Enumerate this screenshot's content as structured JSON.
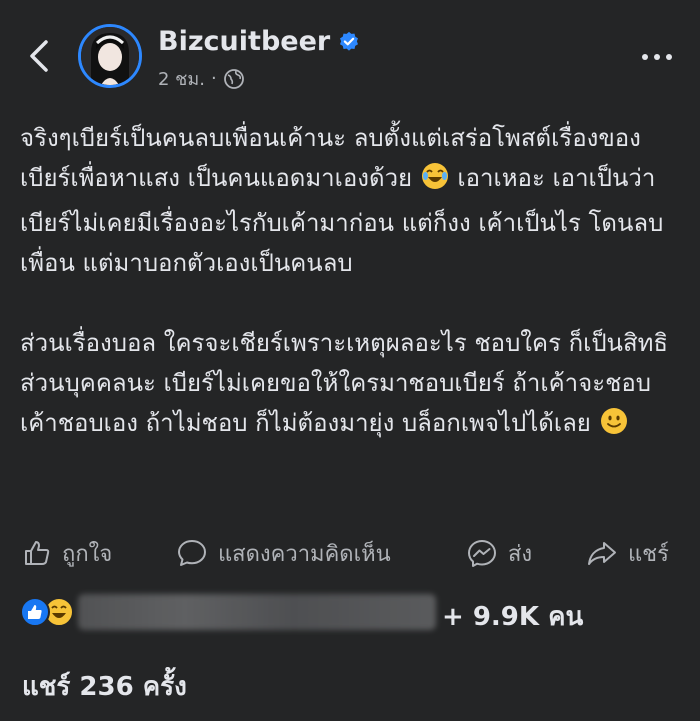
{
  "header": {
    "author_name": "Bizcuitbeer",
    "time": "2 ชม.",
    "separator": "·",
    "verified_icon": "verified-badge-icon",
    "privacy_icon": "globe-icon",
    "accent_color": "#2d88ff"
  },
  "post": {
    "paragraph1_text": "จริงๆเบียร์เป็นคนลบเพื่อนเค้านะ ลบตั้งแต่เสร่อโพสต์เรื่องของเบียร์เพื่อหาแสง เป็นคนแอดมาเองด้วย",
    "paragraph1_emoji": "😂",
    "paragraph1_text2": " เอาเหอะ เอาเป็นว่าเบียร์ไม่เคยมีเรื่องอะไรกับเค้ามาก่อน แต่ก็งง เค้าเป็นไร โดนลบเพื่อน แต่มาบอกตัวเองเป็นคนลบ",
    "paragraph2_text": "ส่วนเรื่องบอล ใครจะเชียร์เพราะเหตุผลอะไร ชอบใคร ก็เป็นสิทธิส่วนบุคคลนะ เบียร์ไม่เคยขอให้ใครมาชอบเบียร์ ถ้าเค้าจะชอบ เค้าชอบเอง ถ้าไม่ชอบ ก็ไม่ต้องมายุ่ง บล็อกเพจไปได้เลย",
    "paragraph2_emoji": "🙂"
  },
  "actions": {
    "like": "ถูกใจ",
    "comment": "แสดงความคิดเห็น",
    "send": "ส่ง",
    "share": "แชร์"
  },
  "reactions": {
    "icons": [
      "like-reaction-icon",
      "haha-reaction-icon"
    ],
    "count_text": "+ 9.9K คน"
  },
  "shares": {
    "text": "แชร์ 236 ครั้ง"
  }
}
